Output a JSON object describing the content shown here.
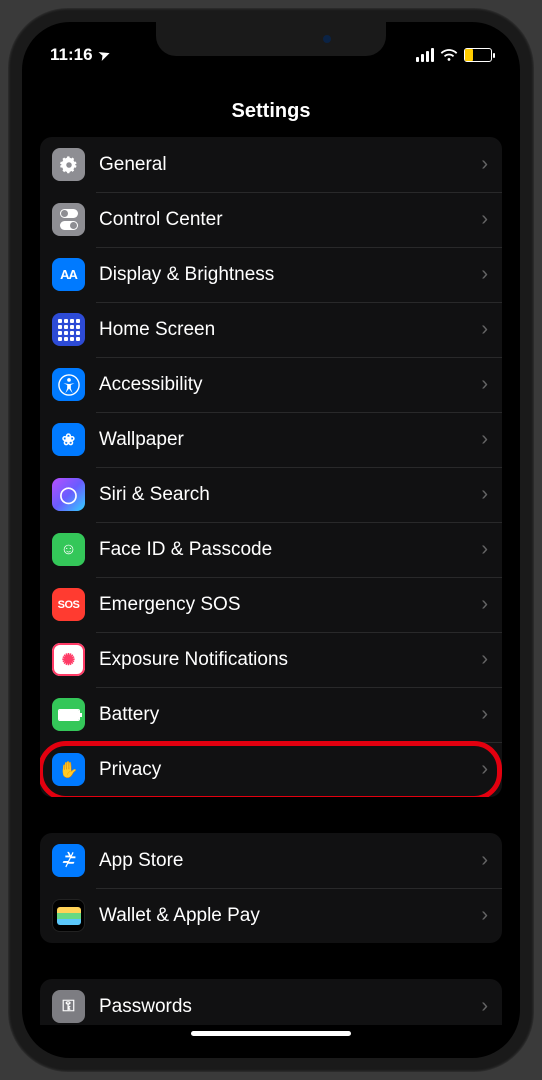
{
  "status": {
    "time": "11:16",
    "location_glyph": "➤"
  },
  "header": {
    "title": "Settings"
  },
  "groups": [
    {
      "items": [
        {
          "label": "General",
          "icon": "gear-icon",
          "tint": "ic-gray",
          "glyph": "⚙︎"
        },
        {
          "label": "Control Center",
          "icon": "switches-icon",
          "tint": "ic-gray",
          "glyph": "⊞"
        },
        {
          "label": "Display & Brightness",
          "icon": "text-size-icon",
          "tint": "ic-blue",
          "glyph": "AA"
        },
        {
          "label": "Home Screen",
          "icon": "grid-icon",
          "tint": "ic-darkblue",
          "glyph": "▦"
        },
        {
          "label": "Accessibility",
          "icon": "accessibility-icon",
          "tint": "ic-blue",
          "glyph": "☉"
        },
        {
          "label": "Wallpaper",
          "icon": "flower-icon",
          "tint": "ic-blue",
          "glyph": "❀"
        },
        {
          "label": "Siri & Search",
          "icon": "siri-icon",
          "tint": "ic-grad",
          "glyph": "◯"
        },
        {
          "label": "Face ID & Passcode",
          "icon": "faceid-icon",
          "tint": "ic-green",
          "glyph": "☺"
        },
        {
          "label": "Emergency SOS",
          "icon": "sos-icon",
          "tint": "ic-red",
          "glyph": "SOS"
        },
        {
          "label": "Exposure Notifications",
          "icon": "exposure-icon",
          "tint": "ic-white",
          "glyph": "✺"
        },
        {
          "label": "Battery",
          "icon": "battery-icon",
          "tint": "ic-green",
          "glyph": "▬"
        },
        {
          "label": "Privacy",
          "icon": "hand-icon",
          "tint": "ic-blue",
          "glyph": "✋",
          "highlighted": true
        }
      ]
    },
    {
      "items": [
        {
          "label": "App Store",
          "icon": "appstore-icon",
          "tint": "ic-blue",
          "glyph": "A"
        },
        {
          "label": "Wallet & Apple Pay",
          "icon": "wallet-icon",
          "tint": "ic-black",
          "glyph": "▭"
        }
      ]
    },
    {
      "peek": true,
      "items": [
        {
          "label": "Passwords",
          "icon": "key-icon",
          "tint": "ic-key",
          "glyph": "⚿"
        }
      ]
    }
  ]
}
